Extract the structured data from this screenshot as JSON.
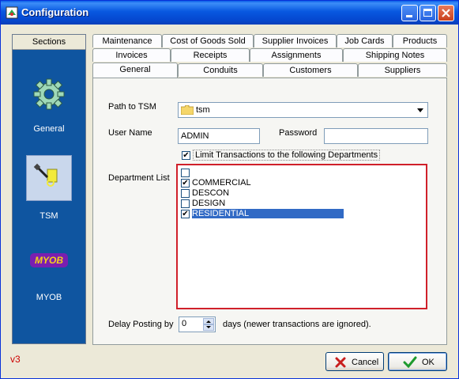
{
  "window": {
    "title": "Configuration"
  },
  "sidebar": {
    "header": "Sections",
    "items": [
      {
        "label": "General",
        "icon": "gear-icon"
      },
      {
        "label": "TSM",
        "icon": "tsm-icon"
      },
      {
        "label": "MYOB",
        "icon": "myob-logo",
        "logo_text": "MYOB"
      }
    ]
  },
  "tabs": {
    "row1": [
      "Maintenance",
      "Cost of Goods Sold",
      "Supplier Invoices",
      "Job Cards",
      "Products"
    ],
    "row2": [
      "Invoices",
      "Receipts",
      "Assignments",
      "Shipping Notes"
    ],
    "row3": [
      "General",
      "Conduits",
      "Customers",
      "Suppliers"
    ],
    "active": "General"
  },
  "form": {
    "path_label": "Path to TSM",
    "path_value": "tsm",
    "user_label": "User Name",
    "user_value": "ADMIN",
    "password_label": "Password",
    "password_value": "",
    "limit_label": "Limit Transactions to the following Departments",
    "limit_checked": true,
    "dept_label": "Department List",
    "departments": [
      {
        "name": "",
        "checked": false
      },
      {
        "name": "COMMERCIAL",
        "checked": true
      },
      {
        "name": "DESCON",
        "checked": false
      },
      {
        "name": "DESIGN",
        "checked": false
      },
      {
        "name": "RESIDENTIAL",
        "checked": true,
        "selected": true
      }
    ],
    "delay_label": "Delay Posting by",
    "delay_value": "0",
    "delay_suffix": "days (newer transactions are ignored)."
  },
  "footer": {
    "version": "v3",
    "cancel_label": "Cancel",
    "ok_label": "OK"
  },
  "colors": {
    "sidebar_bg": "#0f55a0",
    "list_border": "#d0202a",
    "selection": "#316ac5",
    "version_text": "#cc0000"
  }
}
